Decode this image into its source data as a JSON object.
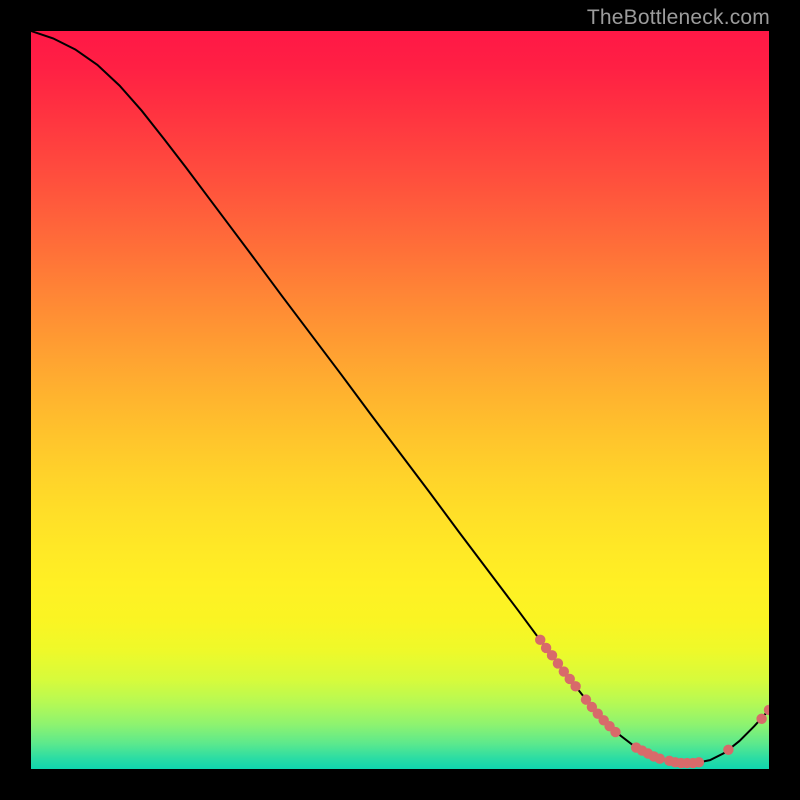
{
  "watermark": "TheBottleneck.com",
  "colors": {
    "curve_stroke": "#000000",
    "marker_fill": "#d86a6a",
    "marker_stroke": "#d86a6a"
  },
  "chart_data": {
    "type": "line",
    "title": "",
    "xlabel": "",
    "ylabel": "",
    "xlim": [
      0,
      100
    ],
    "ylim": [
      0,
      100
    ],
    "grid": false,
    "legend": false,
    "curve": [
      {
        "x": 0,
        "y": 100.0
      },
      {
        "x": 3,
        "y": 99.0
      },
      {
        "x": 6,
        "y": 97.5
      },
      {
        "x": 9,
        "y": 95.4
      },
      {
        "x": 12,
        "y": 92.6
      },
      {
        "x": 15,
        "y": 89.2
      },
      {
        "x": 18,
        "y": 85.4
      },
      {
        "x": 21,
        "y": 81.5
      },
      {
        "x": 24,
        "y": 77.5
      },
      {
        "x": 27,
        "y": 73.5
      },
      {
        "x": 30,
        "y": 69.5
      },
      {
        "x": 34,
        "y": 64.1
      },
      {
        "x": 38,
        "y": 58.8
      },
      {
        "x": 42,
        "y": 53.5
      },
      {
        "x": 46,
        "y": 48.1
      },
      {
        "x": 50,
        "y": 42.8
      },
      {
        "x": 54,
        "y": 37.5
      },
      {
        "x": 58,
        "y": 32.1
      },
      {
        "x": 62,
        "y": 26.8
      },
      {
        "x": 66,
        "y": 21.5
      },
      {
        "x": 70,
        "y": 16.1
      },
      {
        "x": 73,
        "y": 12.2
      },
      {
        "x": 76,
        "y": 8.4
      },
      {
        "x": 79,
        "y": 5.2
      },
      {
        "x": 82,
        "y": 2.9
      },
      {
        "x": 85,
        "y": 1.4
      },
      {
        "x": 88,
        "y": 0.8
      },
      {
        "x": 90,
        "y": 0.8
      },
      {
        "x": 92,
        "y": 1.2
      },
      {
        "x": 94,
        "y": 2.2
      },
      {
        "x": 96,
        "y": 3.8
      },
      {
        "x": 98,
        "y": 5.8
      },
      {
        "x": 100,
        "y": 8.0
      }
    ],
    "markers": [
      {
        "x": 69.0,
        "y": 17.5
      },
      {
        "x": 69.8,
        "y": 16.4
      },
      {
        "x": 70.6,
        "y": 15.4
      },
      {
        "x": 71.4,
        "y": 14.3
      },
      {
        "x": 72.2,
        "y": 13.2
      },
      {
        "x": 73.0,
        "y": 12.2
      },
      {
        "x": 73.8,
        "y": 11.2
      },
      {
        "x": 75.2,
        "y": 9.4
      },
      {
        "x": 76.0,
        "y": 8.4
      },
      {
        "x": 76.8,
        "y": 7.5
      },
      {
        "x": 77.6,
        "y": 6.6
      },
      {
        "x": 78.4,
        "y": 5.8
      },
      {
        "x": 79.2,
        "y": 5.0
      },
      {
        "x": 82.0,
        "y": 2.9
      },
      {
        "x": 82.8,
        "y": 2.5
      },
      {
        "x": 83.6,
        "y": 2.1
      },
      {
        "x": 84.4,
        "y": 1.7
      },
      {
        "x": 85.2,
        "y": 1.4
      },
      {
        "x": 86.5,
        "y": 1.1
      },
      {
        "x": 87.3,
        "y": 0.9
      },
      {
        "x": 88.1,
        "y": 0.8
      },
      {
        "x": 88.9,
        "y": 0.8
      },
      {
        "x": 89.7,
        "y": 0.8
      },
      {
        "x": 90.5,
        "y": 0.9
      },
      {
        "x": 94.5,
        "y": 2.6
      },
      {
        "x": 99.0,
        "y": 6.8
      },
      {
        "x": 100.0,
        "y": 8.0
      }
    ],
    "gradient_stops": [
      {
        "offset": 0.0,
        "color": "#ff1846"
      },
      {
        "offset": 0.05,
        "color": "#ff2044"
      },
      {
        "offset": 0.1,
        "color": "#ff2f41"
      },
      {
        "offset": 0.15,
        "color": "#ff3f3f"
      },
      {
        "offset": 0.2,
        "color": "#ff4f3d"
      },
      {
        "offset": 0.25,
        "color": "#ff603b"
      },
      {
        "offset": 0.3,
        "color": "#ff7138"
      },
      {
        "offset": 0.35,
        "color": "#ff8336"
      },
      {
        "offset": 0.4,
        "color": "#ff9433"
      },
      {
        "offset": 0.45,
        "color": "#ffa531"
      },
      {
        "offset": 0.5,
        "color": "#ffb52e"
      },
      {
        "offset": 0.55,
        "color": "#ffc42c"
      },
      {
        "offset": 0.6,
        "color": "#ffd22a"
      },
      {
        "offset": 0.65,
        "color": "#ffde28"
      },
      {
        "offset": 0.7,
        "color": "#ffe826"
      },
      {
        "offset": 0.75,
        "color": "#fff024"
      },
      {
        "offset": 0.8,
        "color": "#faf523"
      },
      {
        "offset": 0.84,
        "color": "#eef92a"
      },
      {
        "offset": 0.88,
        "color": "#d6fb3c"
      },
      {
        "offset": 0.91,
        "color": "#b6f954"
      },
      {
        "offset": 0.94,
        "color": "#8df370"
      },
      {
        "offset": 0.965,
        "color": "#5de98c"
      },
      {
        "offset": 0.985,
        "color": "#2cdda3"
      },
      {
        "offset": 1.0,
        "color": "#0fd6af"
      }
    ]
  }
}
